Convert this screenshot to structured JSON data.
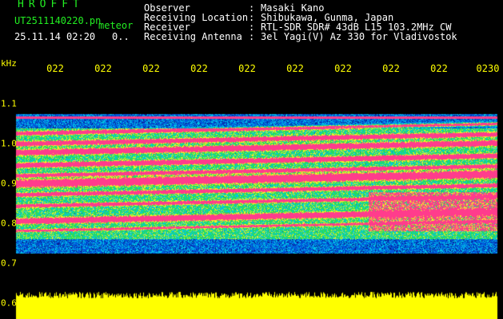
{
  "header": {
    "app_title": "HROFFT",
    "file_name": "UT2511140220.pn",
    "mode_label": "meteor",
    "date_time": "25.11.14 02:20",
    "counter": "0..",
    "info": [
      {
        "label": "Observer",
        "value": "Masaki Kano"
      },
      {
        "label": "Receiving Location",
        "value": "Shibukawa, Gunma, Japan"
      },
      {
        "label": "Receiver",
        "value": "RTL-SDR SDR# 43dB L15 103.2MHz CW"
      },
      {
        "label": "Receiving Antenna",
        "value": "3el Yagi(V) Az 330 for Vladivostok"
      }
    ],
    "separator": ":"
  },
  "plot": {
    "unit_label": "kHz",
    "x_ticks": [
      "022",
      "022",
      "022",
      "022",
      "022",
      "022",
      "022",
      "022",
      "022",
      "0230"
    ],
    "y_ticks": [
      "1.1",
      "1.0",
      "0.9",
      "0.8",
      "0.7",
      "0.6"
    ]
  },
  "colors": {
    "background": "#000000",
    "title_text": "#22ee22",
    "axis_text": "#ffff00",
    "info_text": "#ffffff",
    "spectrogram_background": "#060a44",
    "spectrogram_signal": "#ff2a8a",
    "power_bar": "#ffff00"
  }
}
